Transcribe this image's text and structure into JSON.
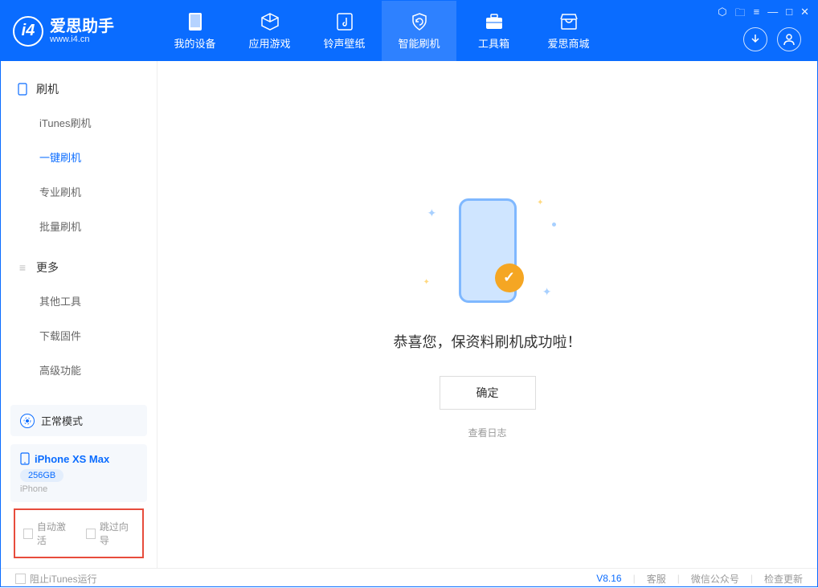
{
  "app": {
    "title": "爱思助手",
    "subtitle": "www.i4.cn"
  },
  "nav": {
    "tabs": [
      {
        "label": "我的设备"
      },
      {
        "label": "应用游戏"
      },
      {
        "label": "铃声壁纸"
      },
      {
        "label": "智能刷机"
      },
      {
        "label": "工具箱"
      },
      {
        "label": "爱思商城"
      }
    ]
  },
  "sidebar": {
    "section1": {
      "title": "刷机",
      "items": [
        {
          "label": "iTunes刷机"
        },
        {
          "label": "一键刷机"
        },
        {
          "label": "专业刷机"
        },
        {
          "label": "批量刷机"
        }
      ]
    },
    "section2": {
      "title": "更多",
      "items": [
        {
          "label": "其他工具"
        },
        {
          "label": "下载固件"
        },
        {
          "label": "高级功能"
        }
      ]
    },
    "mode": "正常模式",
    "device": {
      "name": "iPhone XS Max",
      "storage": "256GB",
      "type": "iPhone"
    },
    "checks": {
      "auto_activate": "自动激活",
      "skip_guide": "跳过向导"
    }
  },
  "main": {
    "success": "恭喜您，保资料刷机成功啦！",
    "ok": "确定",
    "view_log": "查看日志"
  },
  "footer": {
    "block_itunes": "阻止iTunes运行",
    "version": "V8.16",
    "support": "客服",
    "wechat": "微信公众号",
    "update": "检查更新"
  }
}
